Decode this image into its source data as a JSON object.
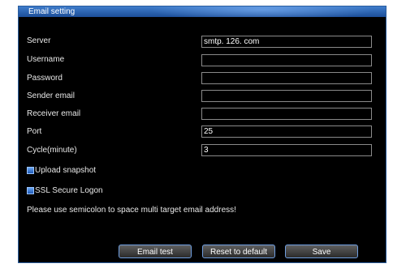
{
  "window": {
    "title": "Email setting"
  },
  "form": {
    "fields": [
      {
        "label": "Server",
        "value": "smtp. 126. com"
      },
      {
        "label": "Username",
        "value": ""
      },
      {
        "label": "Password",
        "value": ""
      },
      {
        "label": "Sender  email",
        "value": ""
      },
      {
        "label": "Receiver  email",
        "value": ""
      },
      {
        "label": "Port",
        "value": "25"
      },
      {
        "label": "Cycle(minute)",
        "value": "3"
      }
    ],
    "checkboxes": [
      {
        "label": "Upload  snapshot",
        "checked": true
      },
      {
        "label": "SSL  Secure  Logon",
        "checked": true
      }
    ],
    "hint": "Please  use  semicolon  to  space  multi  target  email  address!"
  },
  "buttons": {
    "email_test": "Email  test",
    "reset": "Reset  to  default",
    "save": "Save"
  },
  "colors": {
    "title_bar": "#2c63b5",
    "background": "#000000",
    "accent_border": "#6f9ee0"
  }
}
